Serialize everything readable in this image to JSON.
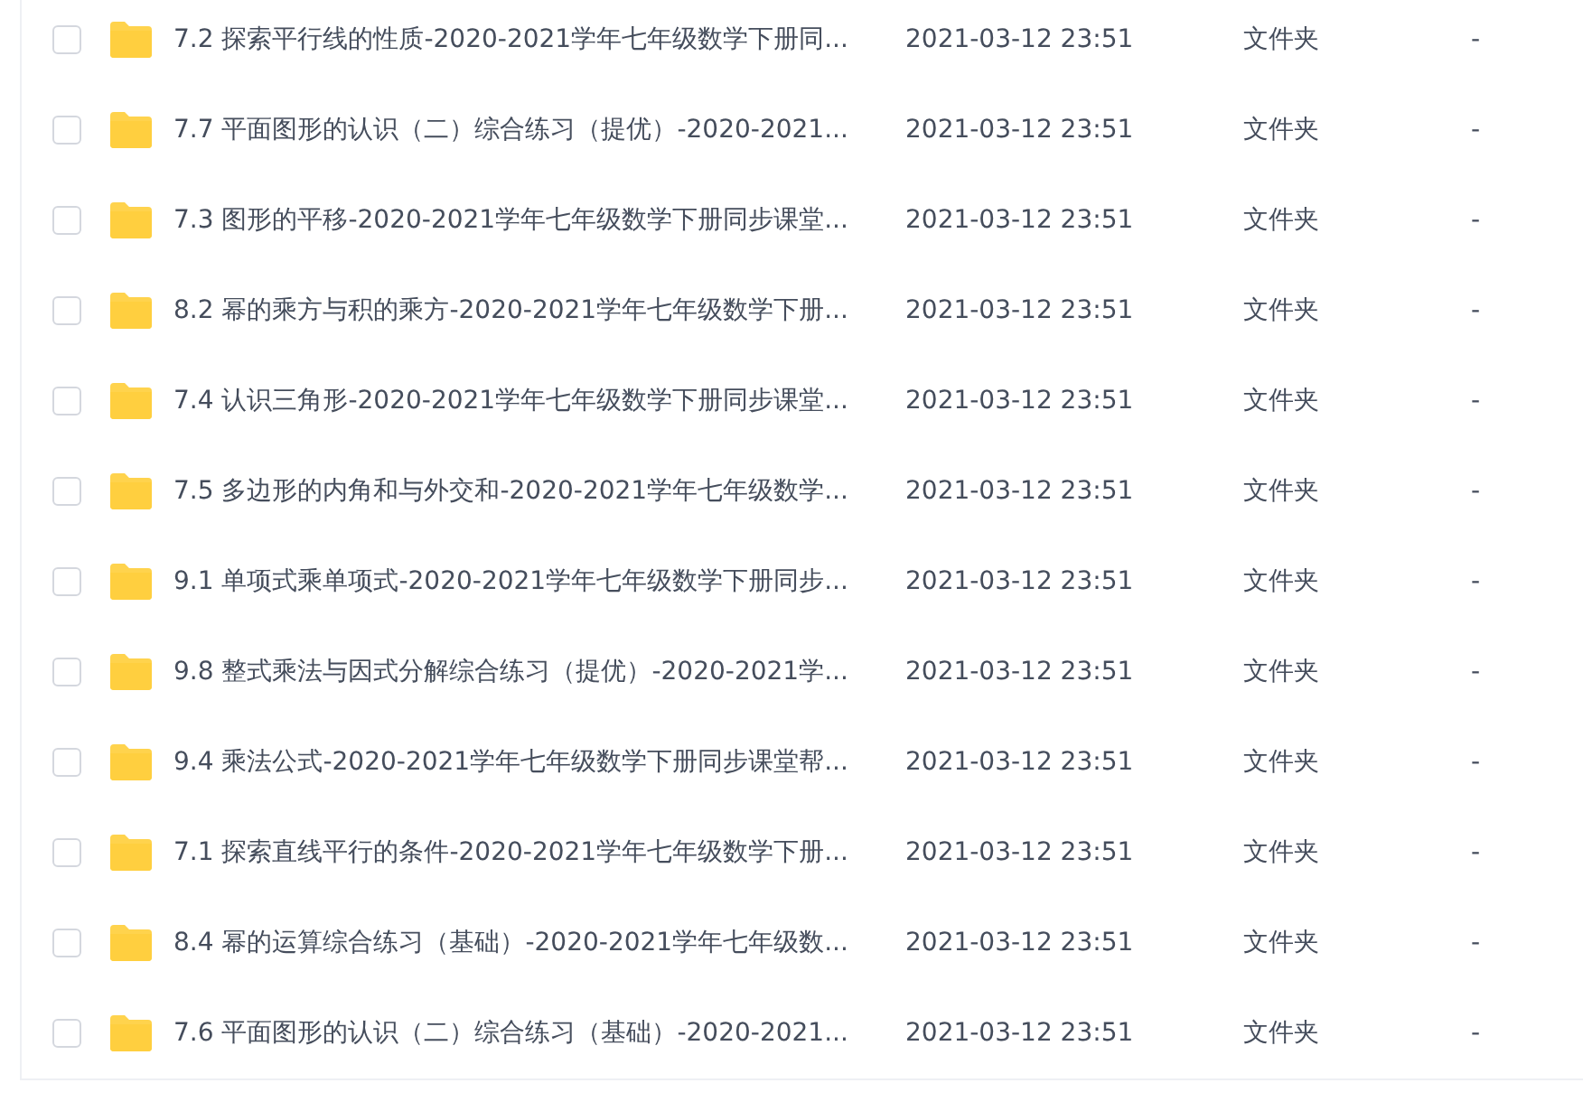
{
  "files": [
    {
      "name": "7.2 探索平行线的性质-2020-2021学年七年级数学下册同...",
      "modified": "2021-03-12 23:51",
      "type": "文件夹",
      "size": "-",
      "checked": false
    },
    {
      "name": "7.7 平面图形的认识（二）综合练习（提优）-2020-2021...",
      "modified": "2021-03-12 23:51",
      "type": "文件夹",
      "size": "-",
      "checked": false
    },
    {
      "name": "7.3 图形的平移-2020-2021学年七年级数学下册同步课堂...",
      "modified": "2021-03-12 23:51",
      "type": "文件夹",
      "size": "-",
      "checked": false
    },
    {
      "name": "8.2 幂的乘方与积的乘方-2020-2021学年七年级数学下册...",
      "modified": "2021-03-12 23:51",
      "type": "文件夹",
      "size": "-",
      "checked": false
    },
    {
      "name": "7.4 认识三角形-2020-2021学年七年级数学下册同步课堂...",
      "modified": "2021-03-12 23:51",
      "type": "文件夹",
      "size": "-",
      "checked": false
    },
    {
      "name": "7.5 多边形的内角和与外交和-2020-2021学年七年级数学...",
      "modified": "2021-03-12 23:51",
      "type": "文件夹",
      "size": "-",
      "checked": false
    },
    {
      "name": "9.1 单项式乘单项式-2020-2021学年七年级数学下册同步...",
      "modified": "2021-03-12 23:51",
      "type": "文件夹",
      "size": "-",
      "checked": false
    },
    {
      "name": "9.8 整式乘法与因式分解综合练习（提优）-2020-2021学...",
      "modified": "2021-03-12 23:51",
      "type": "文件夹",
      "size": "-",
      "checked": false
    },
    {
      "name": "9.4 乘法公式-2020-2021学年七年级数学下册同步课堂帮...",
      "modified": "2021-03-12 23:51",
      "type": "文件夹",
      "size": "-",
      "checked": false
    },
    {
      "name": "7.1 探索直线平行的条件-2020-2021学年七年级数学下册...",
      "modified": "2021-03-12 23:51",
      "type": "文件夹",
      "size": "-",
      "checked": false
    },
    {
      "name": "8.4 幂的运算综合练习（基础）-2020-2021学年七年级数...",
      "modified": "2021-03-12 23:51",
      "type": "文件夹",
      "size": "-",
      "checked": false
    },
    {
      "name": "7.6 平面图形的认识（二）综合练习（基础）-2020-2021...",
      "modified": "2021-03-12 23:51",
      "type": "文件夹",
      "size": "-",
      "checked": false
    }
  ]
}
